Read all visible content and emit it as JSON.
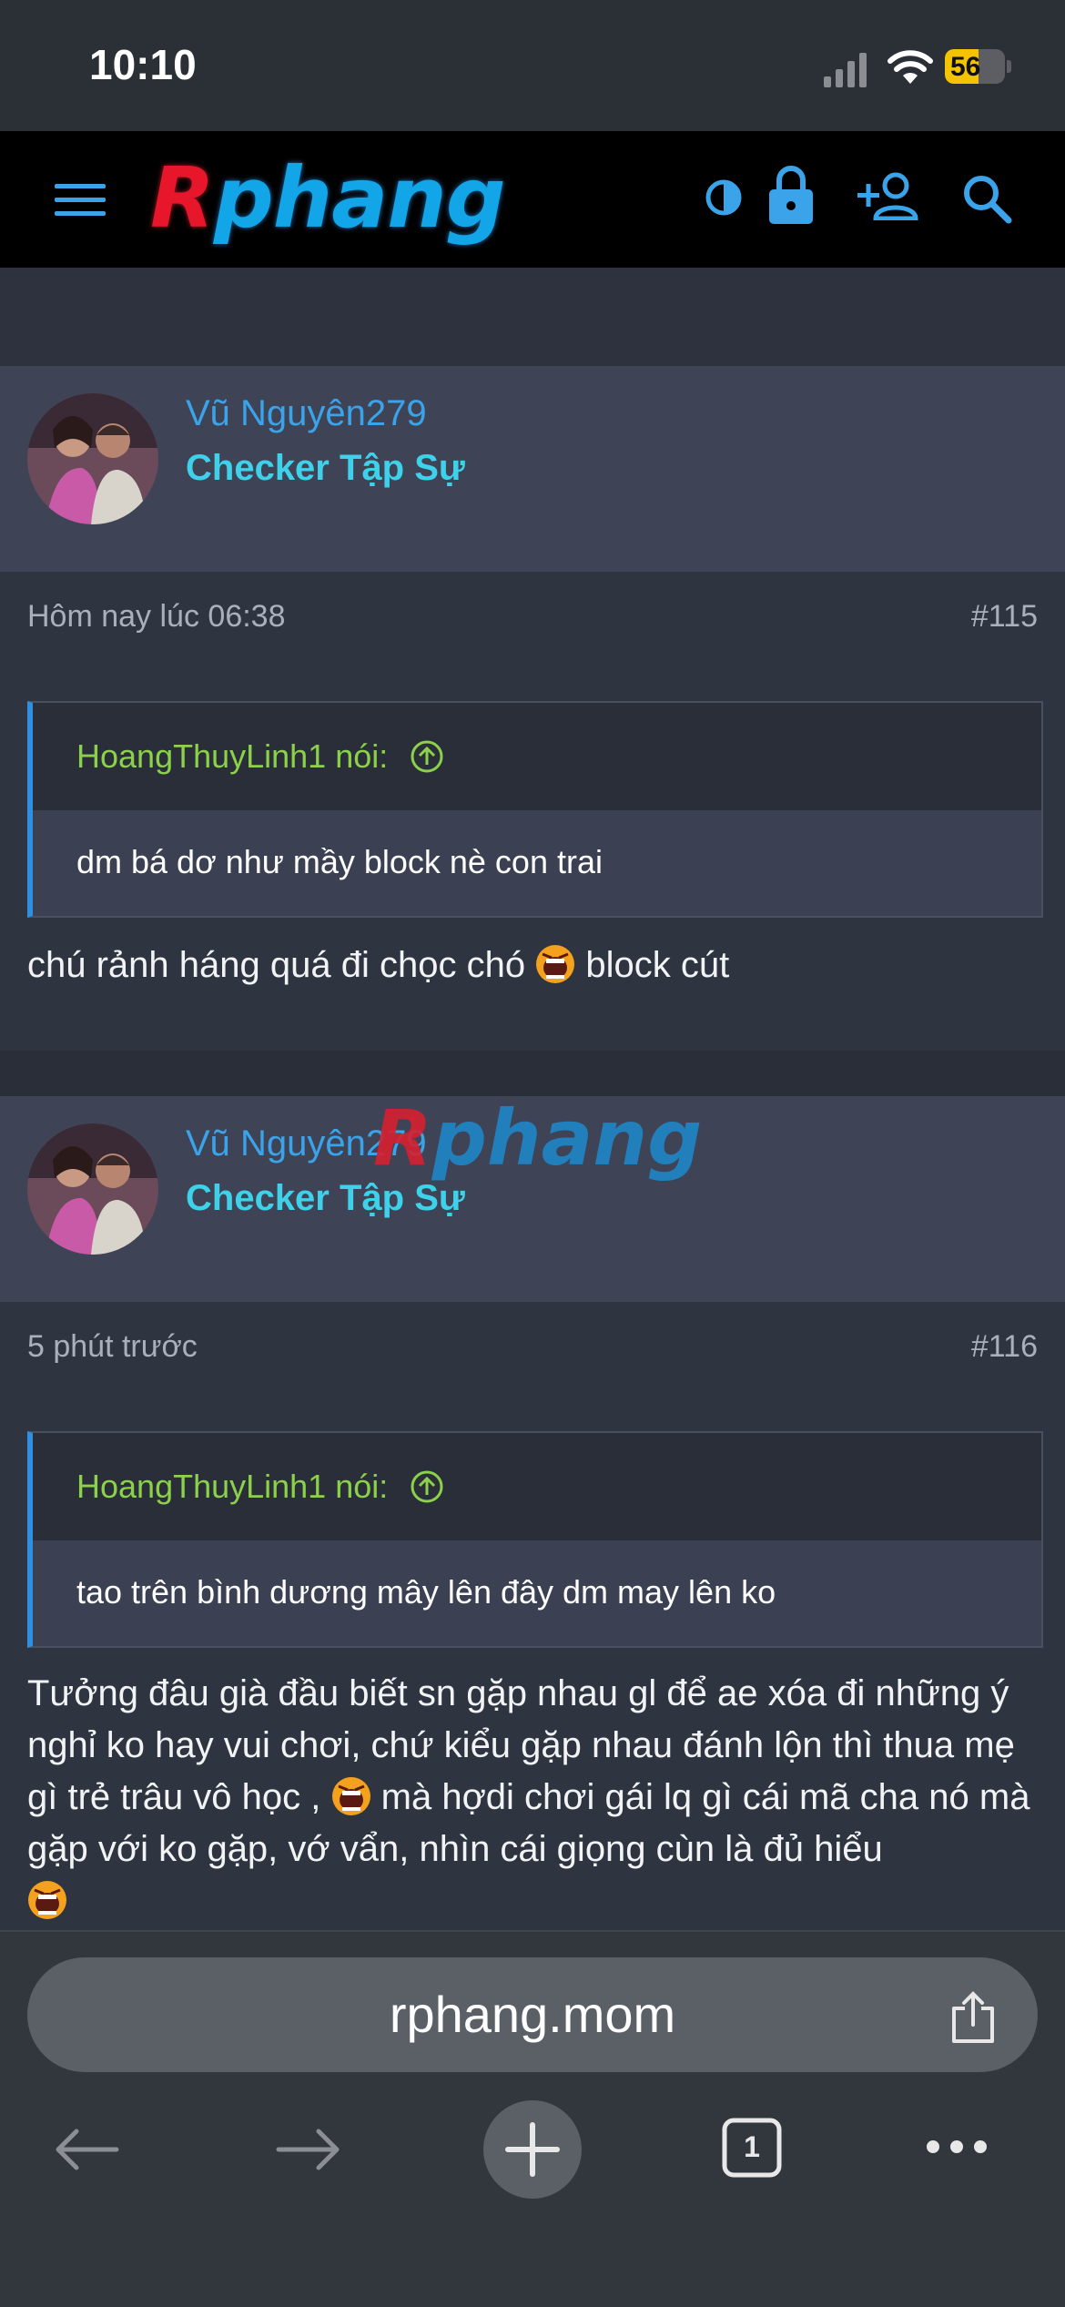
{
  "status": {
    "time": "10:10",
    "battery": "56",
    "battery_level": 0.56
  },
  "header": {
    "logo_text": "Rphang",
    "logo_r": "R",
    "logo_rest": "phang"
  },
  "posts": [
    {
      "username": "Vũ Nguyên279",
      "user_title": "Checker Tập Sự",
      "time": "Hôm nay lúc 06:38",
      "number": "#115",
      "quote_author": "HoangThuyLinh1 nói:",
      "quote_text": "dm bá dơ như mầy block nè con trai",
      "message_before": "chú rảnh háng quá đi chọc chó",
      "message_after": "block cút"
    },
    {
      "username": "Vũ Nguyên279",
      "user_title": "Checker Tập Sự",
      "time": "5 phút trước",
      "number": "#116",
      "quote_author": "HoangThuyLinh1 nói:",
      "quote_text": "tao trên bình dương mây lên đây dm may lên ko",
      "message_part1": "Tưởng đâu già đầu biết sn gặp nhau gl để ae xóa đi những ý nghỉ ko hay vui chơi, chứ kiểu gặp nhau đánh lộn thì thua mẹ gì trẻ trâu vô học ,",
      "message_part2": "mà hợdi chơi gái lq gì cái mã cha nó mà gặp với ko gặp, vớ vẩn, nhìn cái giọng cùn là đủ hiểu"
    }
  ],
  "watermark": {
    "r": "R",
    "rest": "phang"
  },
  "browser": {
    "url": "rphang.mom",
    "tab_count": "1"
  },
  "colors": {
    "accent": "#3aa3ea",
    "quote_author": "#8bd14a",
    "user_title": "#3fd0ea"
  }
}
